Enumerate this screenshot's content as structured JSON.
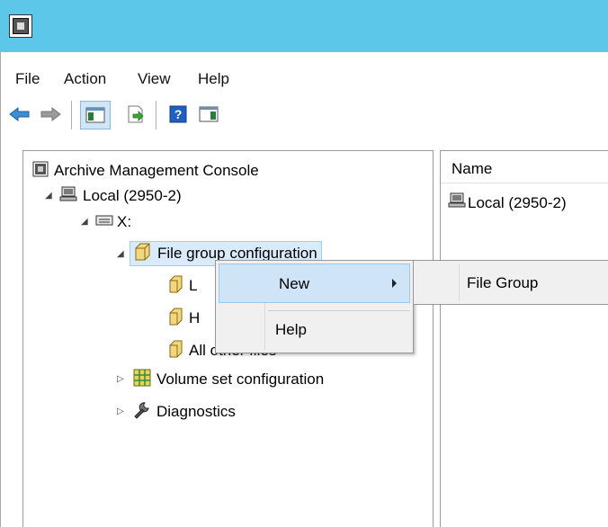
{
  "window": {
    "app_icon": "mmc-console-icon"
  },
  "menu": {
    "items": [
      {
        "label": "File"
      },
      {
        "label": "Action"
      },
      {
        "label": "View"
      },
      {
        "label": "Help"
      }
    ]
  },
  "toolbar": {
    "buttons": [
      "back-arrow-icon",
      "forward-arrow-icon",
      "show-hide-tree-icon",
      "export-list-icon",
      "help-icon",
      "show-action-pane-icon"
    ]
  },
  "tree": {
    "root": {
      "label": "Archive Management Console"
    },
    "local": {
      "label": "Local (2950-2)"
    },
    "drive": {
      "label": "X:"
    },
    "file_group_config": {
      "label": "File group configuration"
    },
    "child1": {
      "label": "L"
    },
    "child2": {
      "label": "H"
    },
    "child3": {
      "label": "All other files"
    },
    "volume_set": {
      "label": "Volume set configuration"
    },
    "diagnostics": {
      "label": "Diagnostics"
    }
  },
  "list": {
    "column_name": "Name",
    "rows": [
      {
        "label": "Local (2950-2)"
      }
    ]
  },
  "context_menu": {
    "new_label": "New",
    "help_label": "Help",
    "submenu": {
      "file_group_label": "File Group"
    }
  },
  "colors": {
    "titlebar": "#5cc7e8",
    "selection": "#cfe4f7",
    "menu_bg": "#f0f0f0"
  }
}
